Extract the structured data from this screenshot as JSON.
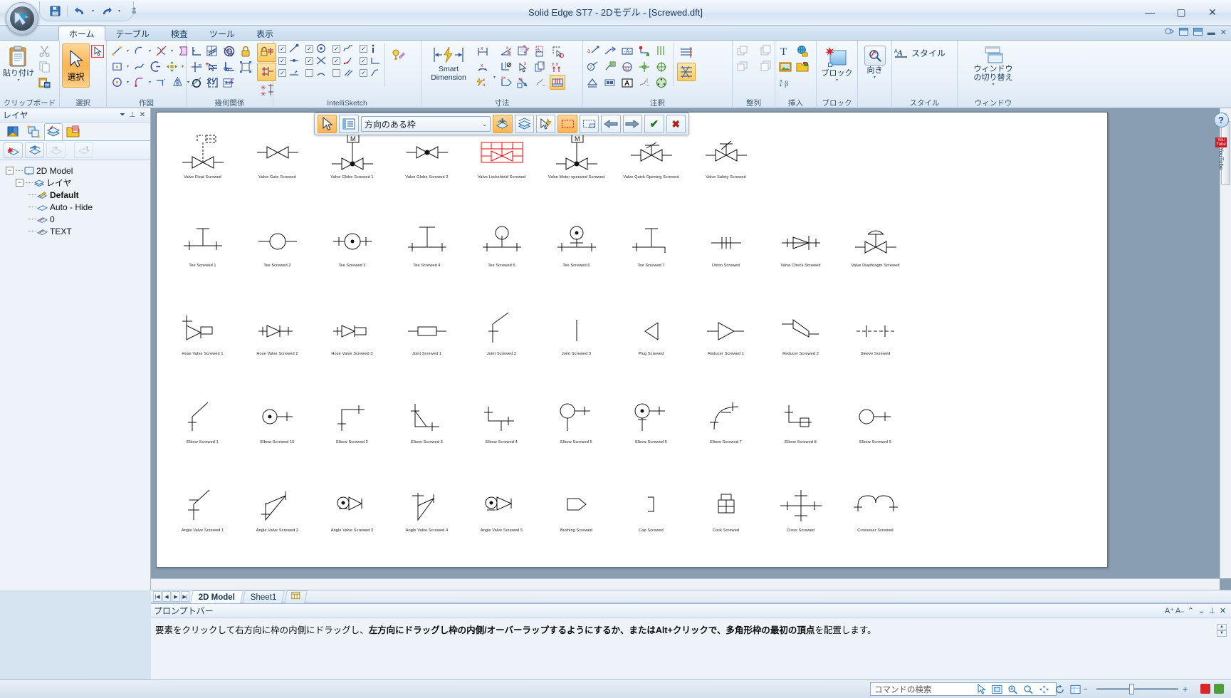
{
  "window": {
    "title": "Solid Edge ST7 - 2Dモデル - [Screwed.dft]",
    "minimize": "—",
    "maximize": "▢",
    "close": "✕"
  },
  "quick_access": {
    "save": "save-icon",
    "undo": "undo-icon",
    "redo": "redo-icon",
    "customize": "customize-icon"
  },
  "tabs": [
    {
      "label": "ホーム",
      "active": true
    },
    {
      "label": "テーブル",
      "active": false
    },
    {
      "label": "検査",
      "active": false
    },
    {
      "label": "ツール",
      "active": false
    },
    {
      "label": "表示",
      "active": false
    }
  ],
  "ribbon_groups": [
    {
      "name": "クリップボード",
      "paste_label": "貼り付け"
    },
    {
      "name": "選択",
      "select_label": "選択"
    },
    {
      "name": "作図"
    },
    {
      "name": "幾何関係"
    },
    {
      "name": "IntelliSketch"
    },
    {
      "name": "寸法",
      "smart_dimension_label": "Smart\nDimension",
      "smart_dimension_line1": "Smart",
      "smart_dimension_line2": "Dimension"
    },
    {
      "name": "注釈"
    },
    {
      "name": "整列"
    },
    {
      "name": "挿入"
    },
    {
      "name": "ブロック",
      "block_label": "ブロック"
    },
    {
      "name": "スタイル",
      "orient_label": "向き",
      "style_label": "スタイル"
    },
    {
      "name": "ウィンドウ",
      "switch_label_1": "ウィンドウ",
      "switch_label_2": "の切り替え"
    }
  ],
  "ribbon_group_labels": [
    "クリップボード",
    "選択",
    "作図",
    "幾何関係",
    "IntelliSketch",
    "寸法",
    "注釈",
    "整列",
    "挿入",
    "ブロック",
    "スタイル",
    "ウィンドウ"
  ],
  "layer_panel": {
    "title": "レイヤ",
    "collapse_icon": "chevron-down-icon",
    "pin_icon": "pin-icon",
    "close_icon": "close-icon",
    "tabs": [
      "library-tab",
      "blocks-tab",
      "layers-tab",
      "help-tab"
    ],
    "toolbar": [
      "new-layer",
      "show-layer",
      "hide-layer",
      "layer-properties"
    ],
    "tree": [
      {
        "label": "2D Model",
        "level": 0,
        "expander": "−",
        "bold": false
      },
      {
        "label": "レイヤ",
        "level": 1,
        "expander": "−",
        "bold": false
      },
      {
        "label": "Default",
        "level": 2,
        "expander": "",
        "bold": true
      },
      {
        "label": "Auto - Hide",
        "level": 2,
        "expander": "",
        "bold": false
      },
      {
        "label": "0",
        "level": 2,
        "expander": "",
        "bold": false
      },
      {
        "label": "TEXT",
        "level": 2,
        "expander": "",
        "bold": false
      }
    ]
  },
  "command_bar": {
    "select_tool_icon": "arrow-select-icon",
    "options_icon": "options-list-icon",
    "select_mode_value": "方向のある枠",
    "chevron": "⌄",
    "buttons": [
      "layer-add-icon",
      "layers-icon",
      "quickpick-icon",
      "inside-frame-icon",
      "overlap-frame-icon",
      "previous-arrow-icon",
      "next-arrow-icon",
      "accept-icon",
      "cancel-icon"
    ],
    "accept": "✔",
    "cancel": "✖"
  },
  "symbols": {
    "rows": [
      [
        {
          "label": "Valve Float Screwed",
          "glyph": "valve-float",
          "selected": false
        },
        {
          "label": "Valve Gate Screwed",
          "glyph": "valve-gate",
          "selected": false
        },
        {
          "label": "Valve Globe Screwed 1",
          "glyph": "valve-globe-1",
          "selected": false
        },
        {
          "label": "Valve Globe Screwed 2",
          "glyph": "valve-globe-2",
          "selected": false
        },
        {
          "label": "Valve Lockshield Screwed",
          "glyph": "valve-lockshield",
          "selected": true
        },
        {
          "label": "Valve Motor operated Screwed",
          "glyph": "valve-motor",
          "selected": false
        },
        {
          "label": "Valve Quick Opening Screwed",
          "glyph": "valve-quick",
          "selected": false
        },
        {
          "label": "Valve Safety Screwed",
          "glyph": "valve-safety",
          "selected": false
        }
      ],
      [
        {
          "label": "Tee Screwed 1",
          "glyph": "tee-1",
          "selected": false
        },
        {
          "label": "Tee Screwed 2",
          "glyph": "tee-2",
          "selected": false
        },
        {
          "label": "Tee Screwed 3",
          "glyph": "tee-3",
          "selected": false
        },
        {
          "label": "Tee Screwed 4",
          "glyph": "tee-4",
          "selected": false
        },
        {
          "label": "Tee Screwed 5",
          "glyph": "tee-5",
          "selected": false
        },
        {
          "label": "Tee Screwed 6",
          "glyph": "tee-6",
          "selected": false
        },
        {
          "label": "Tee Screwed 7",
          "glyph": "tee-7",
          "selected": false
        },
        {
          "label": "Union Screwed",
          "glyph": "union",
          "selected": false
        },
        {
          "label": "Valve Check Screwed",
          "glyph": "valve-check",
          "selected": false
        },
        {
          "label": "Valve Diaphragm Screwed",
          "glyph": "valve-diaphragm",
          "selected": false
        }
      ],
      [
        {
          "label": "Hose Valve Screwed 1",
          "glyph": "hose-valve-1",
          "selected": false
        },
        {
          "label": "Hose Valve Screwed 2",
          "glyph": "hose-valve-2",
          "selected": false
        },
        {
          "label": "Hose Valve Screwed 3",
          "glyph": "hose-valve-3",
          "selected": false
        },
        {
          "label": "Joint Screwed 1",
          "glyph": "joint-1",
          "selected": false
        },
        {
          "label": "Joint Screwed 2",
          "glyph": "joint-2",
          "selected": false
        },
        {
          "label": "Joint Screwed 3",
          "glyph": "joint-3",
          "selected": false
        },
        {
          "label": "Plug Screwed",
          "glyph": "plug",
          "selected": false
        },
        {
          "label": "Reducer Screwed 1",
          "glyph": "reducer-1",
          "selected": false
        },
        {
          "label": "Reducer Screwed 2",
          "glyph": "reducer-2",
          "selected": false
        },
        {
          "label": "Sleeve Screwed",
          "glyph": "sleeve",
          "selected": false
        }
      ],
      [
        {
          "label": "Elbow Screwed 1",
          "glyph": "elbow-1",
          "selected": false
        },
        {
          "label": "Elbow Screwed 10",
          "glyph": "elbow-10",
          "selected": false
        },
        {
          "label": "Elbow Screwed 2",
          "glyph": "elbow-2",
          "selected": false
        },
        {
          "label": "Elbow Screwed 3",
          "glyph": "elbow-3",
          "selected": false
        },
        {
          "label": "Elbow Screwed 4",
          "glyph": "elbow-4",
          "selected": false
        },
        {
          "label": "Elbow Screwed 5",
          "glyph": "elbow-5",
          "selected": false
        },
        {
          "label": "Elbow Screwed 6",
          "glyph": "elbow-6",
          "selected": false
        },
        {
          "label": "Elbow Screwed 7",
          "glyph": "elbow-7",
          "selected": false
        },
        {
          "label": "Elbow Screwed 8",
          "glyph": "elbow-8",
          "selected": false
        },
        {
          "label": "Elbow Screwed 9",
          "glyph": "elbow-9",
          "selected": false
        }
      ],
      [
        {
          "label": "Angle Valve Screwed 1",
          "glyph": "angle-valve-1",
          "selected": false
        },
        {
          "label": "Angle Valve Screwed 2",
          "glyph": "angle-valve-2",
          "selected": false
        },
        {
          "label": "Angle Valve Screwed 3",
          "glyph": "angle-valve-3",
          "selected": false
        },
        {
          "label": "Angle Valve Screwed 4",
          "glyph": "angle-valve-4",
          "selected": false
        },
        {
          "label": "Angle Valve Screwed 5",
          "glyph": "angle-valve-5",
          "selected": false
        },
        {
          "label": "Bushing Screwed",
          "glyph": "bushing",
          "selected": false
        },
        {
          "label": "Cap Screwed",
          "glyph": "cap",
          "selected": false
        },
        {
          "label": "Cock Screwed",
          "glyph": "cock",
          "selected": false
        },
        {
          "label": "Cross Screwed",
          "glyph": "cross",
          "selected": false
        },
        {
          "label": "Crossover Screwed",
          "glyph": "crossover",
          "selected": false
        }
      ]
    ],
    "selection_color": "#ff0000"
  },
  "sheet_tabs": {
    "nav": [
      "|◀",
      "◀",
      "▶",
      "▶|"
    ],
    "items": [
      {
        "label": "2D Model",
        "active": true
      },
      {
        "label": "Sheet1",
        "active": false
      },
      {
        "label": "",
        "active": false,
        "icon": "new-sheet-icon"
      }
    ]
  },
  "prompt_bar": {
    "title": "プロンプトバー",
    "text_part1": "要素をクリックして右方向に枠の内側にドラッグし、",
    "text_bold": "左方向にドラッグし枠の内側/オーバーラップするようにするか、またはAlt+クリックで、多角形枠の最初の頂点",
    "text_part2": "を配置します。",
    "full_text": "要素をクリックして右方向に枠の内側にドラッグし、左方向にドラッグし枠の内側/オーバーラップするようにするか、またはAlt+クリックで、多角形枠の最初の頂点を配置します。",
    "icons": [
      "font-increase-icon",
      "font-decrease-icon",
      "chevron-up-icon",
      "chevron-down-icon",
      "pin-icon",
      "close-icon"
    ]
  },
  "status_bar": {
    "search_placeholder": "コマンドの検索",
    "icons": [
      "select-tool-icon",
      "fit-icon",
      "zoom-area-icon",
      "zoom-icon",
      "pan-icon",
      "rotate-icon",
      "sketch-view-icon"
    ],
    "zoom_minus": "−",
    "zoom_plus": "+"
  },
  "help_dock": {
    "help": "?",
    "youtube_badge_line1": "You",
    "youtube_badge_line2": "Tube",
    "youtube_label": "YouTube"
  },
  "colors": {
    "accent_orange": "#ffb451",
    "selection_red": "#ff0000",
    "titlebar_blue": "#d3e2f2",
    "sheet_bg": "#8a9eb2"
  }
}
